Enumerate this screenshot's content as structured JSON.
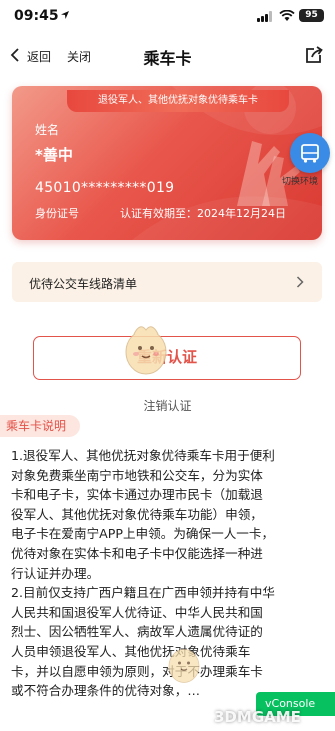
{
  "status_bar": {
    "time": "09:45",
    "battery": "95"
  },
  "nav": {
    "back": "返回",
    "close": "关闭",
    "title": "乘车卡"
  },
  "card": {
    "banner": "退役军人、其他优抚对象优待乘车卡",
    "name_label": "姓名",
    "name": "*善中",
    "id_number": "45010*********019",
    "id_label": "身份证号",
    "expiry": "认证有效期至：2024年12月24日",
    "switch_label": "切换环境"
  },
  "route_list": {
    "label": "优待公交车线路清单"
  },
  "buttons": {
    "reauth": "重新认证",
    "cancel": "注销认证"
  },
  "section": {
    "title": "乘车卡说明",
    "lines": [
      "1.退役军人、其他优抚对象优待乘车卡用于便利",
      "对象免费乘坐南宁市地铁和公交车，分为实体",
      "卡和电子卡，实体卡通过办理市民卡（加载退",
      "役军人、其他优抚对象优待乘车功能）申领，",
      "电子卡在爱南宁APP上申领。为确保一人一卡，",
      "优待对象在实体卡和电子卡中仅能选择一种进",
      "行认证并办理。",
      "2.目前仅支持广西户籍且在广西申领并持有中华",
      "人民共和国退役军人优待证、中华人民共和国",
      "烈士、因公牺牲军人、病故军人遗属优待证的",
      "人员申领退役军人、其他优抚对象优待乘车",
      "卡，并以自愿申领为原则，对于不办理乘车卡",
      "或不符合办理条件的优待对象，…"
    ]
  },
  "overlays": {
    "vconsole": "vConsole",
    "watermark": "3DMGAME"
  },
  "colors": {
    "accent": "#e2534a",
    "card_red": "#e9574c",
    "switch_blue": "#3a8be6",
    "vconsole_green": "#07c160"
  }
}
